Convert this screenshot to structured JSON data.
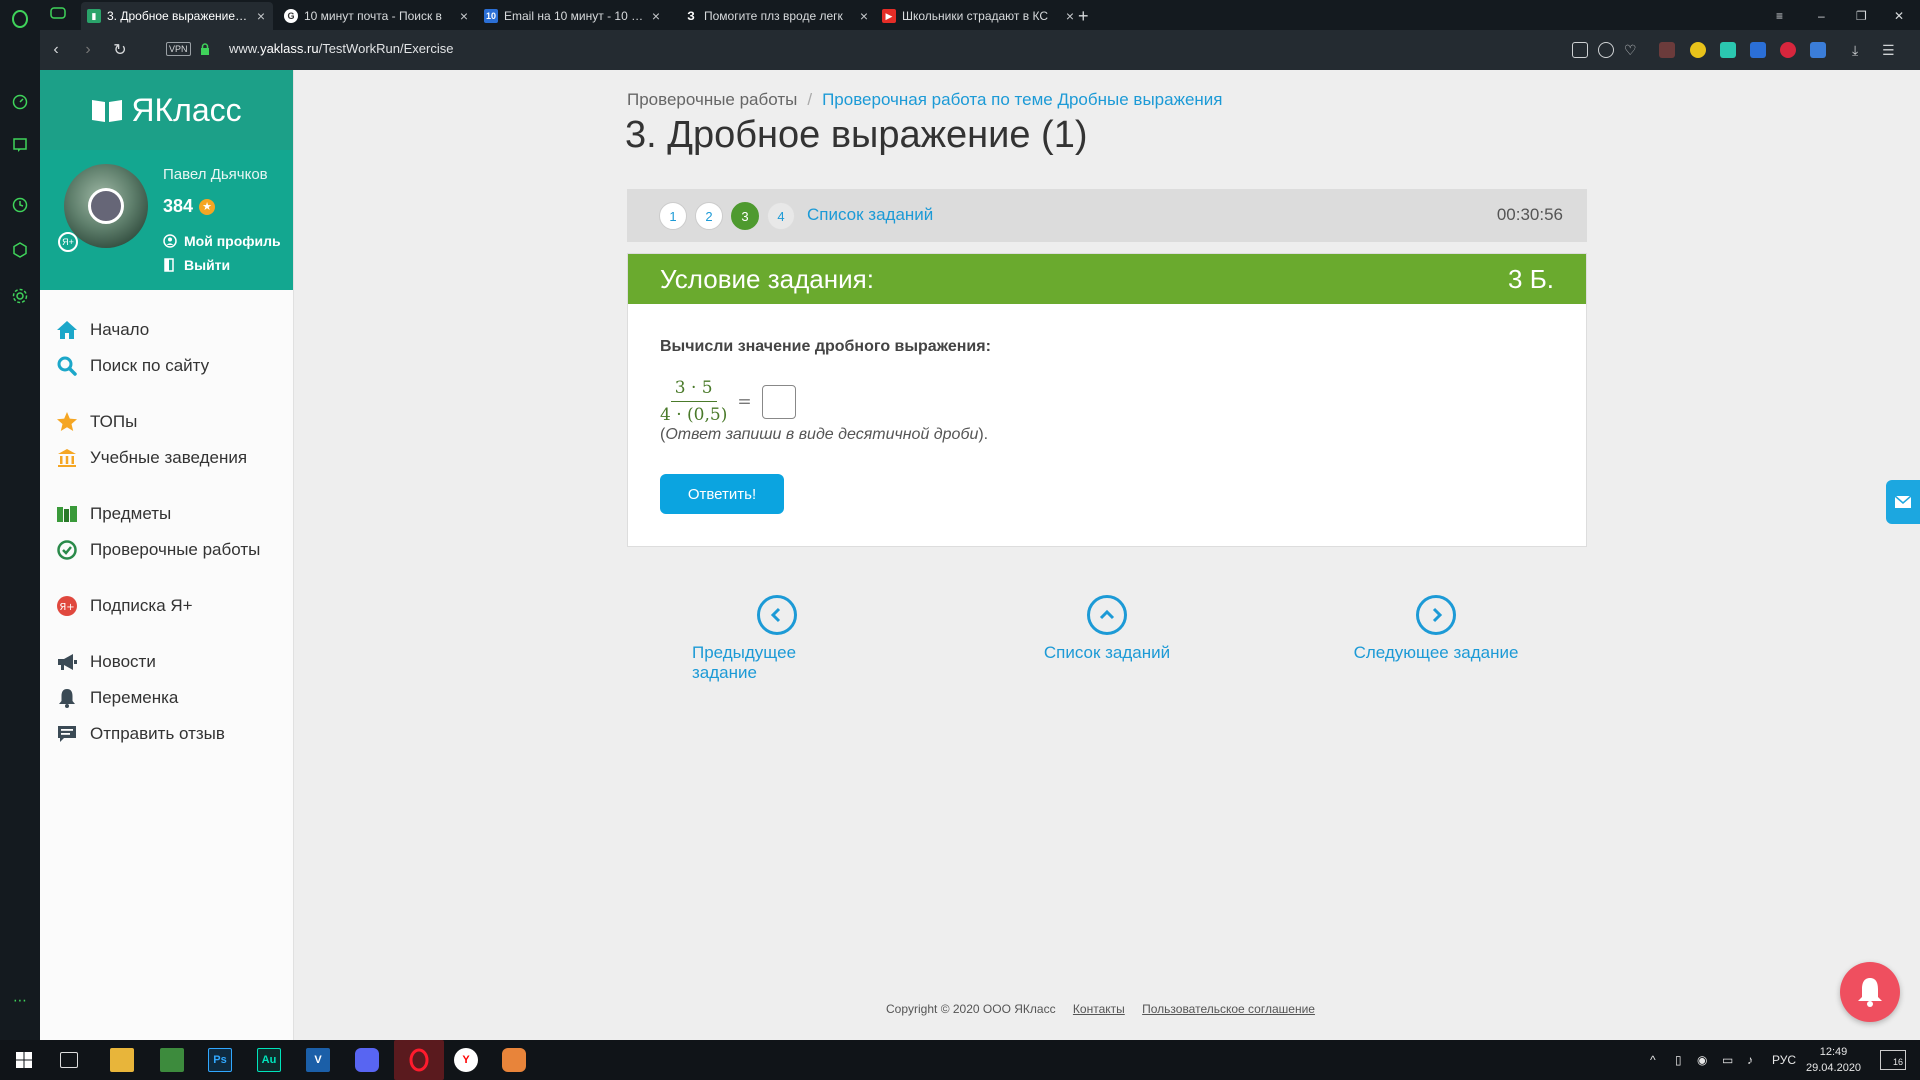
{
  "browser": {
    "tabs": [
      {
        "label": "3. Дробное выражение (1",
        "active": true
      },
      {
        "label": "10 минут почта - Поиск в"
      },
      {
        "label": "Email на 10 минут - 10 ми"
      },
      {
        "label": "Помогите плз вроде легк"
      },
      {
        "label": "Школьники страдают в КС"
      }
    ],
    "vpn_label": "VPN",
    "url_prefix": "www.",
    "url_domain": "yaklass.ru",
    "url_path": "/TestWorkRun/Exercise",
    "new_tab": "+"
  },
  "sidebar": {
    "logo_text": "ЯКласс",
    "user_name": "Павел Дьячков",
    "points": "384",
    "profile_link": "Мой профиль",
    "logout_link": "Выйти",
    "nav": [
      {
        "label": "Начало",
        "icon": "home-icon"
      },
      {
        "label": "Поиск по сайту",
        "icon": "search-icon"
      },
      {
        "label": "ТОПы",
        "icon": "star-icon"
      },
      {
        "label": "Учебные заведения",
        "icon": "building-icon"
      },
      {
        "label": "Предметы",
        "icon": "books-icon"
      },
      {
        "label": "Проверочные работы",
        "icon": "check-circle-icon"
      },
      {
        "label": "Подписка Я+",
        "icon": "ya-plus-icon"
      },
      {
        "label": "Новости",
        "icon": "megaphone-icon"
      },
      {
        "label": "Переменка",
        "icon": "bell-icon"
      },
      {
        "label": "Отправить отзыв",
        "icon": "comment-icon"
      }
    ]
  },
  "breadcrumb": {
    "root": "Проверочные работы",
    "separator": "/",
    "current": "Проверочная работа по теме Дробные выражения"
  },
  "page_title": "3. Дробное выражение (1)",
  "steps": {
    "items": [
      "1",
      "2",
      "3",
      "4"
    ],
    "active": "3",
    "list_link": "Список заданий",
    "timer": "00:30:56"
  },
  "condition": {
    "header": "Условие задания:",
    "score": "3 Б.",
    "question": "Вычисли значение дробного выражения:",
    "numerator": "3 · 5",
    "denominator": "4 · (0,5)",
    "equals": "=",
    "hint_open": "(",
    "hint_text": "Ответ запиши в виде десятичной дроби",
    "hint_close": ").",
    "answer_button": "Ответить!"
  },
  "bottom_nav": {
    "prev": "Предыдущее задание",
    "list": "Список заданий",
    "next": "Следующее задание"
  },
  "footer": {
    "copyright": "Copyright © 2020 ООО ЯКласс",
    "contacts": "Контакты",
    "agreement": "Пользовательское соглашение"
  },
  "windows": {
    "lang": "РУС",
    "time": "12:49",
    "date": "29.04.2020",
    "notif_count": "16"
  },
  "colors": {
    "brand_teal": "#13a790",
    "condition_green": "#6aaa2e",
    "link_blue": "#1c9ad6",
    "button_blue": "#0ba4e0",
    "bell_red": "#ef4f5f"
  }
}
